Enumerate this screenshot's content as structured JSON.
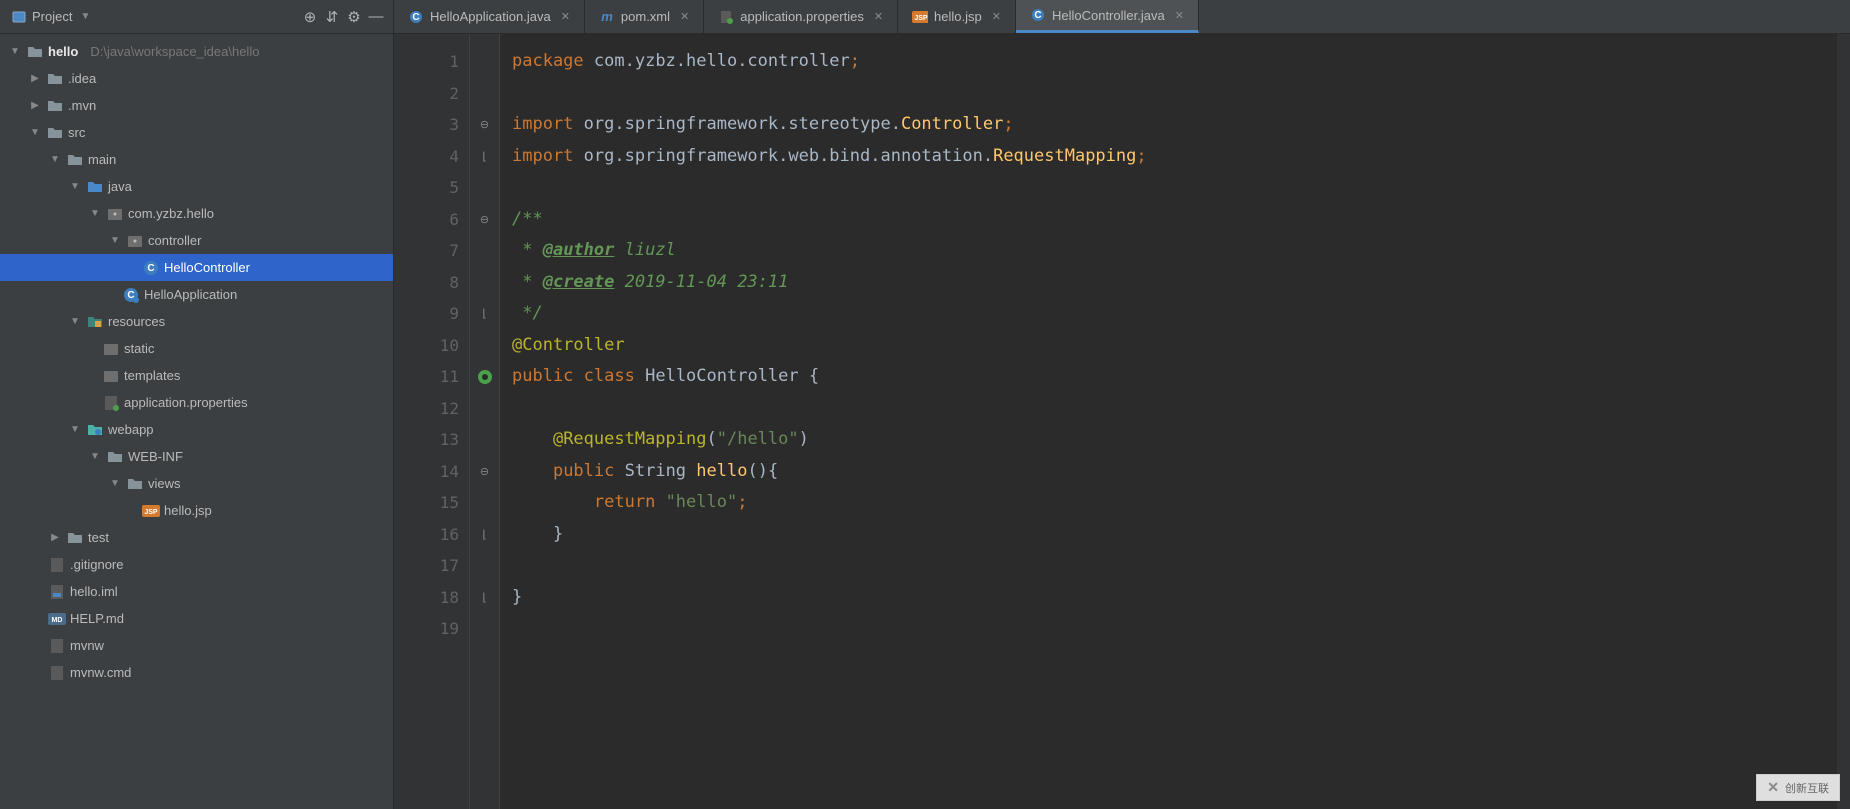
{
  "sidebar": {
    "title": "Project",
    "root": {
      "name": "hello",
      "path": "D:\\java\\workspace_idea\\hello"
    },
    "tree": {
      "idea": ".idea",
      "mvn": ".mvn",
      "src": "src",
      "main": "main",
      "java": "java",
      "package": "com.yzbz.hello",
      "controller": "controller",
      "hello_controller": "HelloController",
      "hello_application": "HelloApplication",
      "resources": "resources",
      "static": "static",
      "templates": "templates",
      "app_props": "application.properties",
      "webapp": "webapp",
      "webinf": "WEB-INF",
      "views": "views",
      "hello_jsp": "hello.jsp",
      "test": "test",
      "gitignore": ".gitignore",
      "hello_iml": "hello.iml",
      "help_md": "HELP.md",
      "mvnw": "mvnw",
      "mvnw_cmd": "mvnw.cmd"
    }
  },
  "tabs": [
    {
      "label": "HelloApplication.java"
    },
    {
      "label": "pom.xml"
    },
    {
      "label": "application.properties"
    },
    {
      "label": "hello.jsp"
    },
    {
      "label": "HelloController.java"
    }
  ],
  "code": {
    "package_kw": "package",
    "package_name": "com.yzbz.hello.controller",
    "import_kw": "import",
    "import1_pre": "org.springframework.stereotype.",
    "import1_cls": "Controller",
    "import2_pre": "org.springframework.web.bind.annotation.",
    "import2_cls": "RequestMapping",
    "doc_open": "/**",
    "doc_star": " * ",
    "doc_author_tag": "@author",
    "doc_author_val": " liuzl",
    "doc_create_tag": "@create",
    "doc_create_val": " 2019-11-04 23:11",
    "doc_close": " */",
    "ann_controller": "@Controller",
    "public_kw": "public",
    "class_kw": "class",
    "class_name": "HelloController",
    "lbrace": "{",
    "rbrace": "}",
    "ann_reqmap": "@RequestMapping",
    "reqmap_arg": "\"/hello\"",
    "ret_type": "String",
    "method_name": "hello",
    "parens": "()",
    "return_kw": "return",
    "return_val": "\"hello\"",
    "semi": ";"
  },
  "line_numbers": [
    "1",
    "2",
    "3",
    "4",
    "5",
    "6",
    "7",
    "8",
    "9",
    "10",
    "11",
    "12",
    "13",
    "14",
    "15",
    "16",
    "17",
    "18",
    "19"
  ],
  "watermark": {
    "brand": "创新互联"
  }
}
